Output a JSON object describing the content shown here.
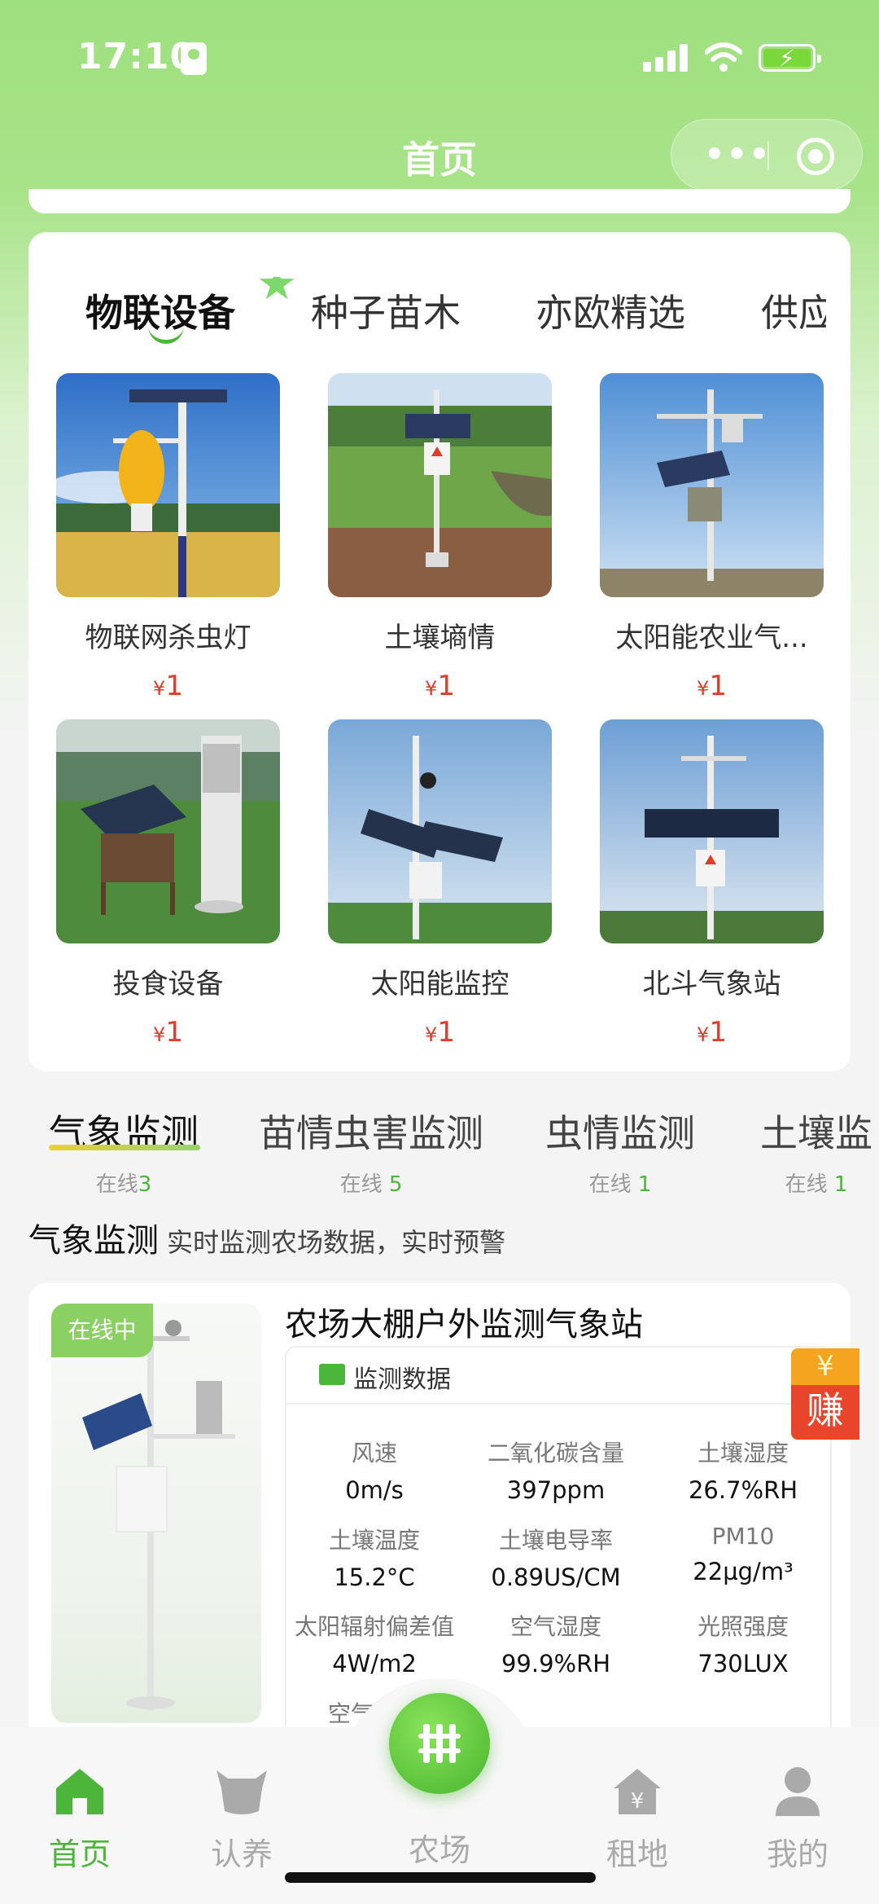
{
  "status_bar": {
    "time": "17:10"
  },
  "nav": {
    "title": "首页",
    "more_icon": "more-dots-icon",
    "close_icon": "target-circle-icon"
  },
  "category_tabs": [
    "物联设备",
    "种子苗木",
    "亦欧精选",
    "供应"
  ],
  "products": [
    {
      "name": "物联网杀虫灯",
      "currency": "¥",
      "price": "1"
    },
    {
      "name": "土壤墒情",
      "currency": "¥",
      "price": "1"
    },
    {
      "name": "太阳能农业气...",
      "currency": "¥",
      "price": "1"
    },
    {
      "name": "投食设备",
      "currency": "¥",
      "price": "1"
    },
    {
      "name": "太阳能监控",
      "currency": "¥",
      "price": "1"
    },
    {
      "name": "北斗气象站",
      "currency": "¥",
      "price": "1"
    }
  ],
  "monitor_tabs": [
    {
      "label": "气象监测",
      "status": "在线",
      "count": "3"
    },
    {
      "label": "苗情虫害监测",
      "status": "在线 ",
      "count": "5"
    },
    {
      "label": "虫情监测",
      "status": "在线 ",
      "count": "1"
    },
    {
      "label": "土壤监",
      "status": "在线 ",
      "count": "1"
    }
  ],
  "section": {
    "title": "气象监测",
    "subtitle": "实时监测农场数据，实时预警"
  },
  "station": {
    "badge": "在线中",
    "title": "农场大棚户外监测气象站",
    "data_header": "监测数据",
    "readings": [
      {
        "label": "风速",
        "value": "0m/s"
      },
      {
        "label": "二氧化碳含量",
        "value": "397ppm"
      },
      {
        "label": "土壤湿度",
        "value": "26.7%RH"
      },
      {
        "label": "土壤温度",
        "value": "15.2°C"
      },
      {
        "label": "土壤电导率",
        "value": "0.89US/CM"
      },
      {
        "label": "PM10",
        "value": "22µg/m³"
      },
      {
        "label": "太阳辐射偏差值",
        "value": "4W/m2"
      },
      {
        "label": "空气湿度",
        "value": "99.9%RH"
      },
      {
        "label": "光照强度",
        "value": "730LUX"
      },
      {
        "label": "空气",
        "value": ""
      }
    ]
  },
  "earn_badge": {
    "symbol": "¥",
    "text": "赚"
  },
  "tab_bar": [
    {
      "label": "首页",
      "icon": "home-icon"
    },
    {
      "label": "认养",
      "icon": "cow-icon"
    },
    {
      "label": "农场",
      "icon": "fence-icon"
    },
    {
      "label": "租地",
      "icon": "rent-house-icon"
    },
    {
      "label": "我的",
      "icon": "person-icon"
    }
  ],
  "colors": {
    "brand_green": "#4cb63a",
    "header_green": "#9fe07e",
    "price_red": "#e23b2a"
  }
}
